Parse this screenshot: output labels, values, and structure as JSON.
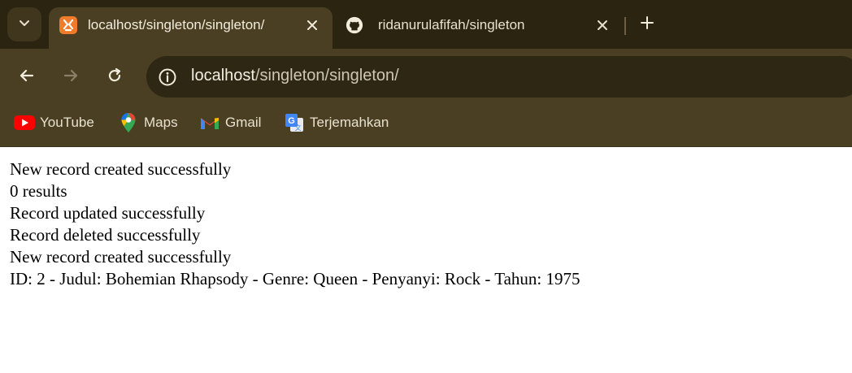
{
  "tabs": [
    {
      "title": "localhost/singleton/singleton/",
      "icon": "xampp-icon",
      "active": true
    },
    {
      "title": "ridanurulafifah/singleton",
      "icon": "github-icon",
      "active": false
    }
  ],
  "address_bar": {
    "host": "localhost",
    "path": "/singleton/singleton/"
  },
  "bookmarks": [
    {
      "label": "YouTube",
      "icon": "youtube-icon"
    },
    {
      "label": "Maps",
      "icon": "maps-icon"
    },
    {
      "label": "Gmail",
      "icon": "gmail-icon"
    },
    {
      "label": "Terjemahkan",
      "icon": "translate-icon"
    }
  ],
  "content": {
    "lines": [
      "New record created successfully",
      "0 results",
      "Record updated successfully",
      "Record deleted successfully",
      "New record created successfully",
      "ID: 2 - Judul: Bohemian Rhapsody - Genre: Queen - Penyanyi: Rock - Tahun: 1975"
    ]
  },
  "colors": {
    "tabstrip": "#2b2410",
    "toolbar": "#4a3f22",
    "omnibox": "#2e2713",
    "xampp_orange": "#f07b2a"
  }
}
